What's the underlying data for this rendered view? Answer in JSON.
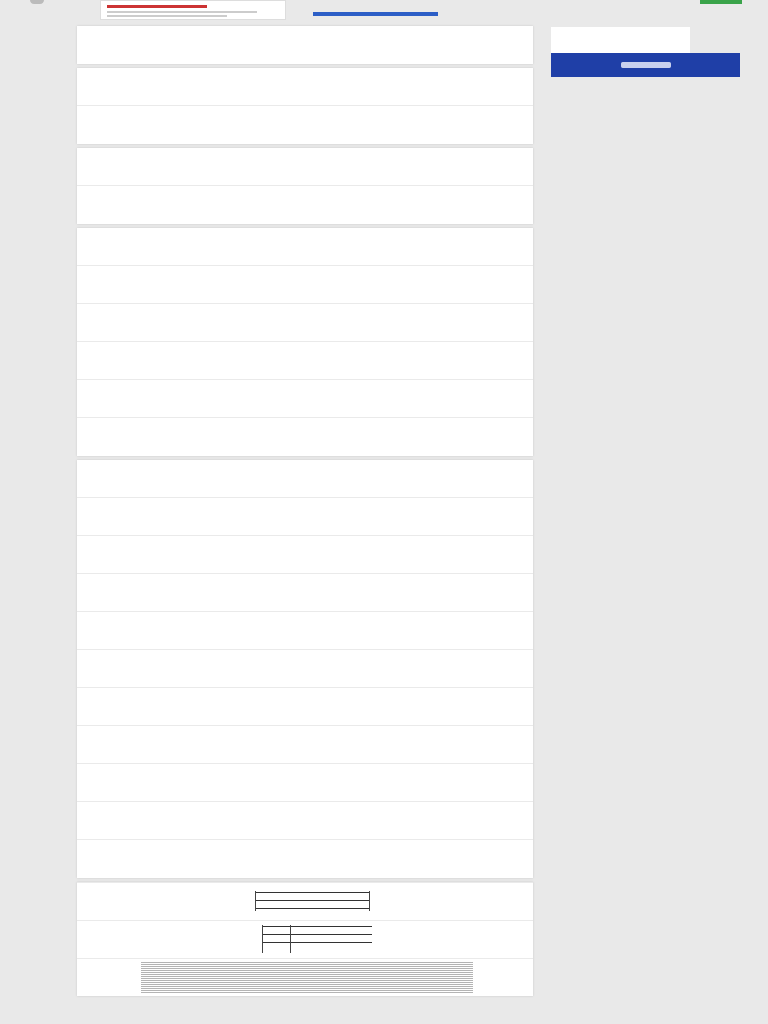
{
  "header": {
    "breadcrumb": "",
    "document_title": "",
    "subtitle": "",
    "primary_button_color": "#2c5ec6",
    "accent_green": "#3aa34a",
    "chips": ""
  },
  "document": {
    "page_groups": [
      {
        "rows": 1
      },
      {
        "rows": 2
      },
      {
        "rows": 2
      },
      {
        "rows": 6
      },
      {
        "rows": 11
      }
    ],
    "rendered_pages": [
      {
        "caption": "",
        "page_number": ""
      },
      {
        "caption": "",
        "page_number": ""
      },
      {
        "caption": "",
        "page_number": ""
      }
    ]
  },
  "sidebar_ad": {
    "text": "",
    "banner_heading": "",
    "banner_footer": "",
    "banner_footer_right": "",
    "banner_color": "#1f3fa7"
  },
  "footer": {
    "text": ""
  }
}
